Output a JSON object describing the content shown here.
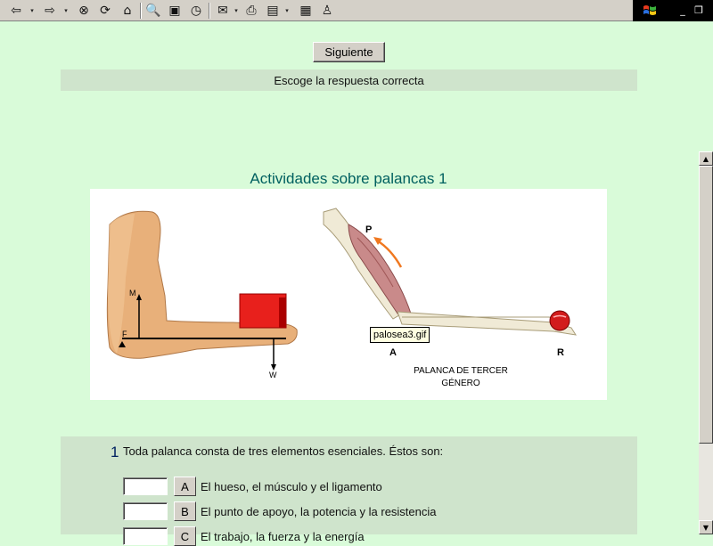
{
  "toolbar": {
    "icons": [
      "back-icon",
      "forward-icon",
      "stop-icon",
      "refresh-icon",
      "home-icon",
      "search-icon",
      "favorites-icon",
      "history-icon",
      "mail-icon",
      "print-icon",
      "edit-icon",
      "discuss-icon",
      "messenger-icon"
    ],
    "glyphs": {
      "back": "⇦",
      "forward": "⇨",
      "stop": "⊗",
      "refresh": "⟳",
      "home": "⌂",
      "search": "🔍",
      "favorites": "▣",
      "history": "◷",
      "mail": "✉",
      "print": "⎙",
      "edit": "▤",
      "discuss": "▦",
      "messenger": "♙",
      "dropdown": "▾"
    },
    "window_controls": {
      "minimize": "_",
      "restore": "❐"
    }
  },
  "page": {
    "next_label": "Siguiente",
    "instruction": "Escoge la respuesta correcta",
    "title": "Actividades sobre palancas 1"
  },
  "figure": {
    "left": {
      "label_m": "M",
      "label_f": "F",
      "label_w": "W"
    },
    "right": {
      "label_p": "P",
      "label_a": "A",
      "label_r": "R",
      "caption_line1": "PALANCA DE TERCER",
      "caption_line2": "GÉNERO"
    },
    "tooltip": "palosea3.gif"
  },
  "question": {
    "number": "1",
    "text": "Toda palanca consta de tres elementos esenciales. Éstos son:",
    "answers": [
      {
        "letter": "A",
        "text": "El hueso, el músculo y el ligamento"
      },
      {
        "letter": "B",
        "text": "El punto de apoyo, la potencia y la resistencia"
      },
      {
        "letter": "C",
        "text": "El trabajo, la fuerza y la energía"
      }
    ]
  },
  "colors": {
    "background": "#d9fbd9",
    "panel": "#cfe4cc",
    "title": "#006060",
    "toolbar": "#d4d0c8"
  }
}
